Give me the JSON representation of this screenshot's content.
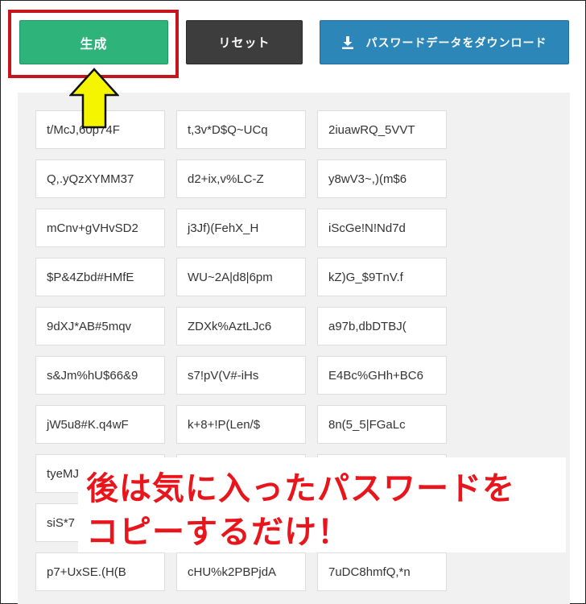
{
  "buttons": {
    "generate": "生成",
    "reset": "リセット",
    "download": "パスワードデータをダウンロード"
  },
  "passwords": [
    [
      "t/McJ,60p74F",
      "t,3v*D$Q~UCq",
      "2iuawRQ_5VVT"
    ],
    [
      "Q,.yQzXYMM37",
      "d2+ix,v%LC-Z",
      "y8wV3~,)(m$6"
    ],
    [
      "mCnv+gVHvSD2",
      "j3Jf)(FehX_H",
      "iScGe!N!Nd7d"
    ],
    [
      "$P&4Zbd#HMfE",
      "WU~2A|d8|6pm",
      "kZ)G_$9TnV.f"
    ],
    [
      "9dXJ*AB#5mqv",
      "ZDXk%AztLJc6",
      "a97b,dbDTBJ("
    ],
    [
      "s&Jm%hU$66&9",
      "s7!pV(V#-iHs",
      "E4Bc%GHh+BC6"
    ],
    [
      "jW5u8#K.q4wF",
      "k+8+!P(Len/$",
      "8n(5_5|FGaLc"
    ],
    [
      "tyeMJ",
      "",
      ""
    ],
    [
      "siS*7",
      "",
      ""
    ],
    [
      "p7+UxSE.(H(B",
      "cHU%k2PBPjdA",
      "7uDC8hmfQ,*n"
    ]
  ],
  "annotation": {
    "line1": "後は気に入ったパスワードを",
    "line2": "コピーするだけ！"
  },
  "colors": {
    "generate": "#2eb37a",
    "reset": "#3d3d3d",
    "download": "#2c86b7",
    "highlight": "#c4161c",
    "arrow": "#f5f500",
    "annotation_text": "#e8161c"
  },
  "icons": {
    "download": "download-icon",
    "arrow": "arrow-up-icon"
  }
}
